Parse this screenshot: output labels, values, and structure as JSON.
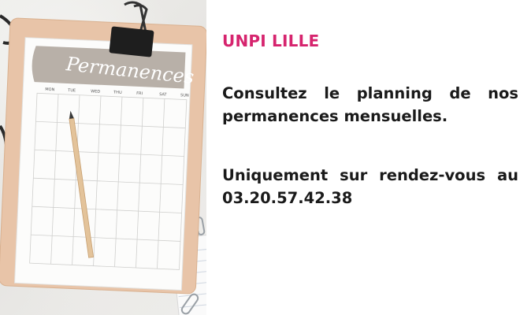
{
  "calendar": {
    "heading": "Permanences",
    "weekdays": [
      "MON",
      "TUE",
      "WED",
      "THU",
      "FRI",
      "SAT",
      "SUN"
    ]
  },
  "content": {
    "title": "UNPI LILLE",
    "paragraph1": "Consultez le planning de nos permanences mensuelles.",
    "paragraph2": "Uniquement sur rendez-vous au 03.20.57.42.38"
  },
  "colors": {
    "title": "#d6246e",
    "body_text": "#1a1a1a",
    "clipboard": "#e8c4a8",
    "calendar_header": "#b8b0a8"
  }
}
